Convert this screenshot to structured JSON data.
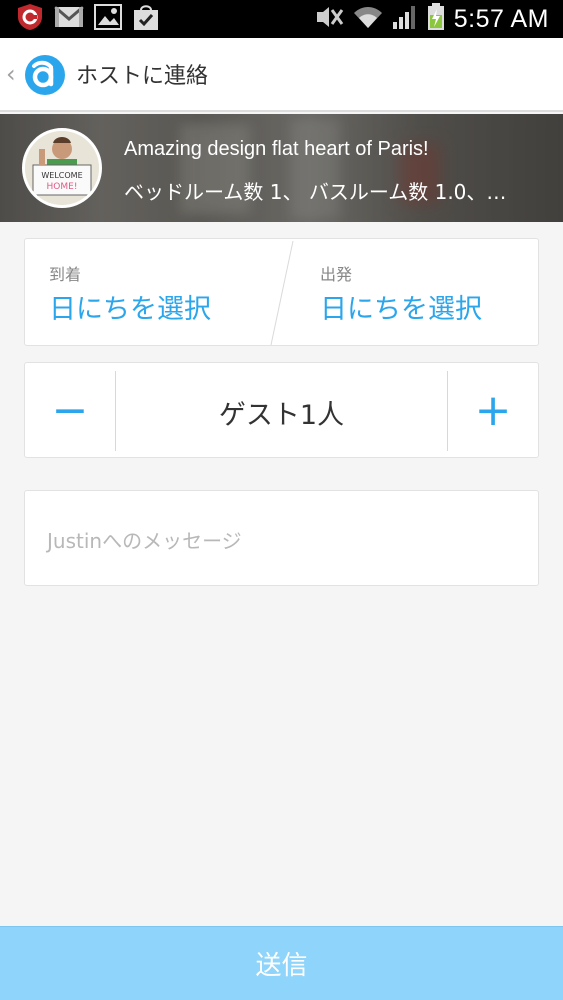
{
  "status_bar": {
    "time": "5:57 AM",
    "icons_left": [
      "shield-app-icon",
      "gmail-icon",
      "gallery-icon",
      "shopping-bag-icon"
    ],
    "icons_right": [
      "silent-mode-icon",
      "wifi-icon",
      "signal-icon",
      "battery-charging-icon"
    ]
  },
  "action_bar": {
    "title": "ホストに連絡",
    "back_icon": "chevron-left-icon",
    "logo": "airbnb-logo"
  },
  "listing": {
    "title": "Amazing design flat heart of Paris!",
    "subtitle": "ベッドルーム数 1、 バスルーム数 1.0、…",
    "avatar_sign": "WELCOME HOME!"
  },
  "dates": {
    "arrival_label": "到着",
    "arrival_value": "日にちを選択",
    "departure_label": "出発",
    "departure_value": "日にちを選択"
  },
  "guests": {
    "minus_label": "−",
    "count_label": "ゲスト1人",
    "plus_label": "+"
  },
  "message": {
    "placeholder": "Justinへのメッセージ",
    "value": ""
  },
  "send": {
    "label": "送信"
  },
  "colors": {
    "accent": "#2ba6ec",
    "send_button": "#8fd4fa",
    "background": "#f5f5f5"
  }
}
